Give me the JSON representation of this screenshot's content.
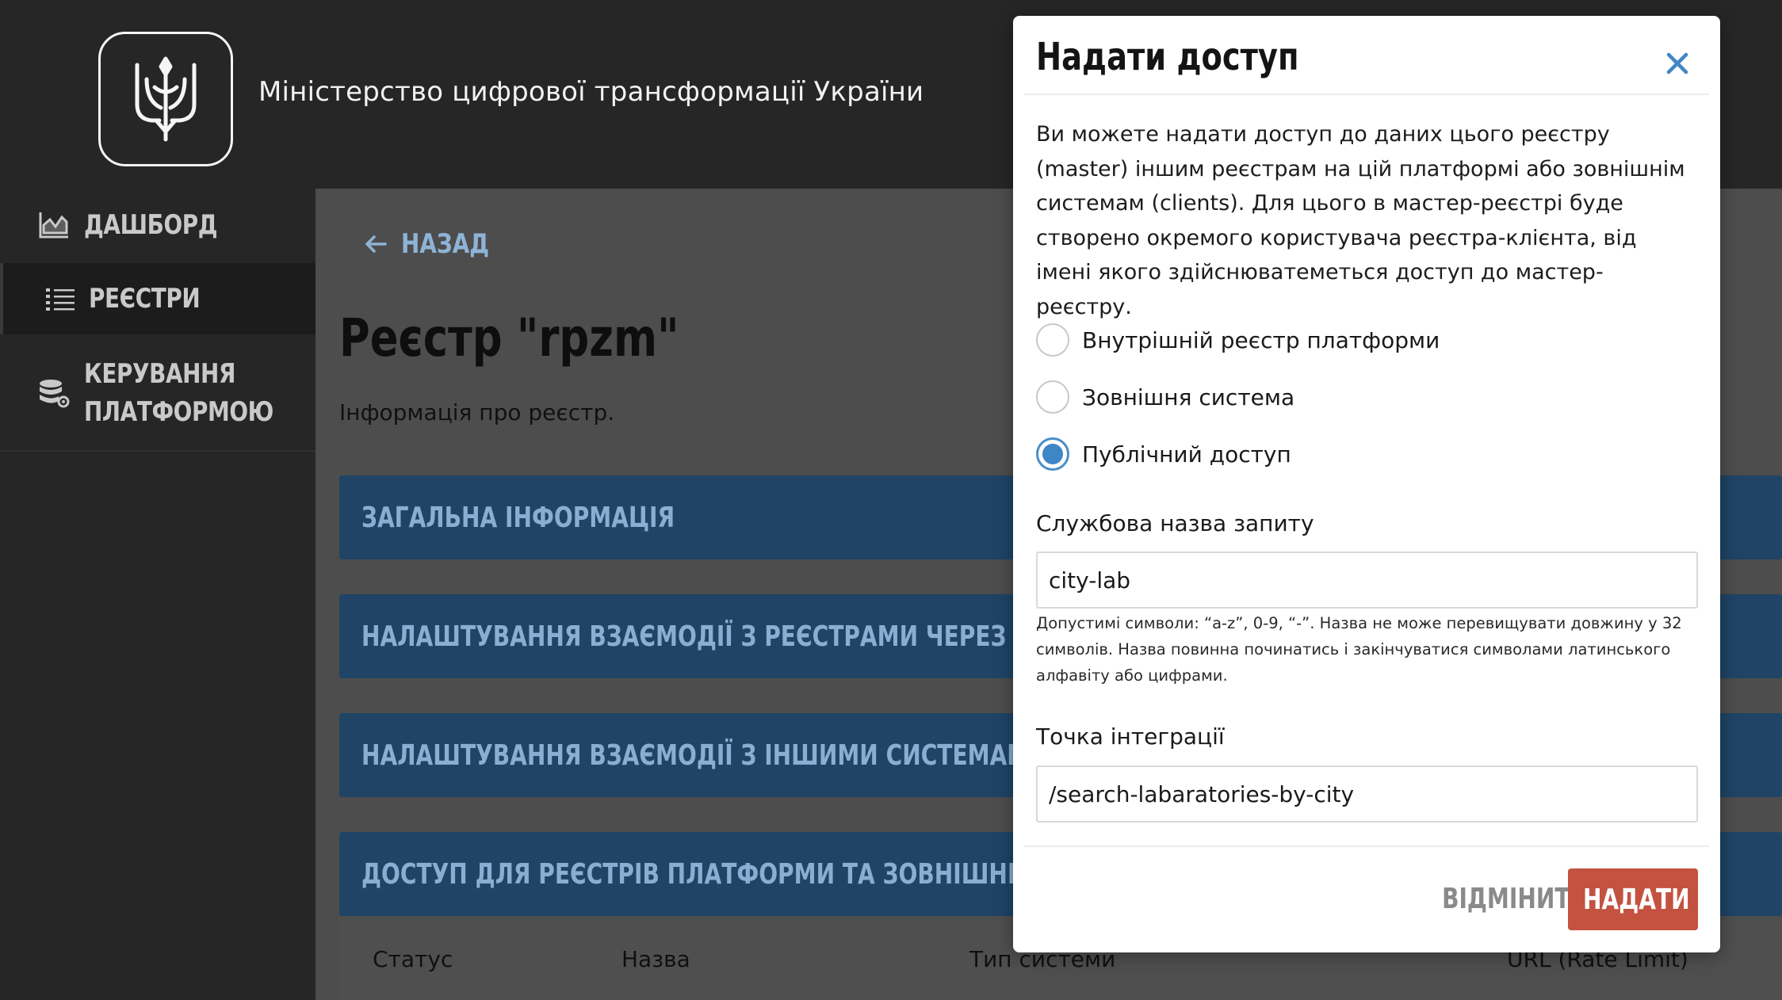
{
  "header": {
    "ministry_title": "Міністерство цифрової трансформації України"
  },
  "sidebar": {
    "items": [
      {
        "label": "ДАШБОРД",
        "icon": "chart-area-icon"
      },
      {
        "label": "РЕЄСТРИ",
        "icon": "list-icon",
        "active": true
      },
      {
        "label": "КЕРУВАННЯ ПЛАТФОРМОЮ",
        "icon": "database-gear-icon"
      }
    ]
  },
  "main": {
    "back_label": "НАЗАД",
    "title": "Реєстр \"rpzm\"",
    "subtitle": "Інформація про реєстр.",
    "sections": [
      "ЗАГАЛЬНА ІНФОРМАЦІЯ",
      "НАЛАШТУВАННЯ ВЗАЄМОДІЇ З РЕЄСТРАМИ ЧЕРЕЗ ТРЕМБІТУ",
      "НАЛАШТУВАННЯ ВЗАЄМОДІЇ З ІНШИМИ СИСТЕМАМИ",
      "ДОСТУП ДЛЯ РЕЄСТРІВ ПЛАТФОРМИ ТА ЗОВНІШНІХ СИСТЕМ"
    ],
    "table_headers": [
      "Статус",
      "Назва",
      "Тип системи",
      "URL (Rate Limit)"
    ]
  },
  "modal": {
    "title": "Надати доступ",
    "description": "Ви можете надати доступ до даних цього реєстру (master) іншим реєстрам на цій платформі або зовнішнім системам (clients). Для цього в мастер-реєстрі буде створено окремого користувача реєстра-клієнта, від імені якого здійснюватеметься доступ до мастер-реєстру.",
    "options": [
      {
        "label": "Внутрішній реєстр платформи",
        "checked": false
      },
      {
        "label": "Зовнішня система",
        "checked": false
      },
      {
        "label": "Публічний доступ",
        "checked": true
      }
    ],
    "service_name_label": "Службова назва запиту",
    "service_name_value": "city-lab",
    "helper_text": "Допустимі символи: “a-z”, 0-9, “-”. Назва не може перевищувати довжину у 32 символів. Назва повинна починатись і закінчуватися символами латинського алфавіту або цифрами.",
    "endpoint_label": "Точка інтеграції",
    "endpoint_value": "/search-labaratories-by-city",
    "cancel_label": "ВІДМІНИТИ",
    "submit_label": "НАДАТИ"
  },
  "colors": {
    "accent_blue": "#3f86c6",
    "section_bar": "#1f4465",
    "submit_button": "#c35240"
  }
}
